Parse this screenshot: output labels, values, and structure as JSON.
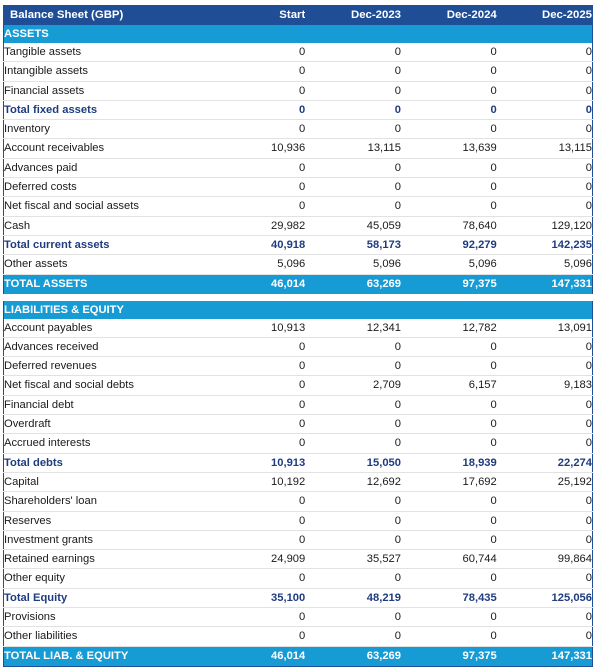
{
  "theme": {
    "header_bg": "#1F4E96",
    "section_bg": "#169BD5",
    "total_bg": "#169BD5",
    "subtotal_text": "#1F3C80",
    "body_text": "#1a1a1a",
    "row_rule": "#E2E2E2"
  },
  "header": {
    "title": "Balance Sheet (GBP)",
    "columns": [
      "Start",
      "Dec-2023",
      "Dec-2024",
      "Dec-2025"
    ]
  },
  "sections": [
    {
      "id": "assets",
      "band_label": "ASSETS",
      "rows": [
        {
          "label": "Tangible assets",
          "emphasis": "normal",
          "values": [
            "0",
            "0",
            "0",
            "0"
          ]
        },
        {
          "label": "Intangible assets",
          "emphasis": "normal",
          "values": [
            "0",
            "0",
            "0",
            "0"
          ]
        },
        {
          "label": "Financial assets",
          "emphasis": "normal",
          "values": [
            "0",
            "0",
            "0",
            "0"
          ]
        },
        {
          "label": "Total fixed assets",
          "emphasis": "subtotal",
          "values": [
            "0",
            "0",
            "0",
            "0"
          ]
        },
        {
          "label": "Inventory",
          "emphasis": "normal",
          "values": [
            "0",
            "0",
            "0",
            "0"
          ]
        },
        {
          "label": "Account receivables",
          "emphasis": "normal",
          "values": [
            "10,936",
            "13,115",
            "13,639",
            "13,115"
          ]
        },
        {
          "label": "Advances paid",
          "emphasis": "normal",
          "values": [
            "0",
            "0",
            "0",
            "0"
          ]
        },
        {
          "label": "Deferred costs",
          "emphasis": "normal",
          "values": [
            "0",
            "0",
            "0",
            "0"
          ]
        },
        {
          "label": "Net fiscal and social assets",
          "emphasis": "normal",
          "values": [
            "0",
            "0",
            "0",
            "0"
          ]
        },
        {
          "label": "Cash",
          "emphasis": "normal",
          "values": [
            "29,982",
            "45,059",
            "78,640",
            "129,120"
          ]
        },
        {
          "label": "Total current assets",
          "emphasis": "subtotal",
          "values": [
            "40,918",
            "58,173",
            "92,279",
            "142,235"
          ]
        },
        {
          "label": "Other assets",
          "emphasis": "normal",
          "values": [
            "5,096",
            "5,096",
            "5,096",
            "5,096"
          ]
        }
      ],
      "total": {
        "label": "TOTAL ASSETS",
        "values": [
          "46,014",
          "63,269",
          "97,375",
          "147,331"
        ]
      }
    },
    {
      "id": "liabilities-equity",
      "band_label": "LIABILITIES & EQUITY",
      "rows": [
        {
          "label": "Account payables",
          "emphasis": "normal",
          "values": [
            "10,913",
            "12,341",
            "12,782",
            "13,091"
          ]
        },
        {
          "label": "Advances received",
          "emphasis": "normal",
          "values": [
            "0",
            "0",
            "0",
            "0"
          ]
        },
        {
          "label": "Deferred revenues",
          "emphasis": "normal",
          "values": [
            "0",
            "0",
            "0",
            "0"
          ]
        },
        {
          "label": "Net fiscal and social debts",
          "emphasis": "normal",
          "values": [
            "0",
            "2,709",
            "6,157",
            "9,183"
          ]
        },
        {
          "label": "Financial debt",
          "emphasis": "normal",
          "values": [
            "0",
            "0",
            "0",
            "0"
          ]
        },
        {
          "label": "Overdraft",
          "emphasis": "normal",
          "values": [
            "0",
            "0",
            "0",
            "0"
          ]
        },
        {
          "label": "Accrued interests",
          "emphasis": "normal",
          "values": [
            "0",
            "0",
            "0",
            "0"
          ]
        },
        {
          "label": "Total debts",
          "emphasis": "subtotal",
          "values": [
            "10,913",
            "15,050",
            "18,939",
            "22,274"
          ]
        },
        {
          "label": "Capital",
          "emphasis": "normal",
          "values": [
            "10,192",
            "12,692",
            "17,692",
            "25,192"
          ]
        },
        {
          "label": "Shareholders' loan",
          "emphasis": "normal",
          "values": [
            "0",
            "0",
            "0",
            "0"
          ]
        },
        {
          "label": "Reserves",
          "emphasis": "normal",
          "values": [
            "0",
            "0",
            "0",
            "0"
          ]
        },
        {
          "label": "Investment grants",
          "emphasis": "normal",
          "values": [
            "0",
            "0",
            "0",
            "0"
          ]
        },
        {
          "label": "Retained earnings",
          "emphasis": "normal",
          "values": [
            "24,909",
            "35,527",
            "60,744",
            "99,864"
          ]
        },
        {
          "label": "Other equity",
          "emphasis": "normal",
          "values": [
            "0",
            "0",
            "0",
            "0"
          ]
        },
        {
          "label": "Total Equity",
          "emphasis": "subtotal",
          "values": [
            "35,100",
            "48,219",
            "78,435",
            "125,056"
          ]
        },
        {
          "label": "Provisions",
          "emphasis": "normal",
          "values": [
            "0",
            "0",
            "0",
            "0"
          ]
        },
        {
          "label": "Other liabilities",
          "emphasis": "normal",
          "values": [
            "0",
            "0",
            "0",
            "0"
          ]
        }
      ],
      "total": {
        "label": "TOTAL LIAB. & EQUITY",
        "values": [
          "46,014",
          "63,269",
          "97,375",
          "147,331"
        ]
      }
    }
  ],
  "chart_data": {
    "type": "table",
    "title": "Balance Sheet (GBP)",
    "columns": [
      "Start",
      "Dec-2023",
      "Dec-2024",
      "Dec-2025"
    ],
    "rows": [
      {
        "section": "ASSETS",
        "label": "Tangible assets",
        "values": [
          0,
          0,
          0,
          0
        ]
      },
      {
        "section": "ASSETS",
        "label": "Intangible assets",
        "values": [
          0,
          0,
          0,
          0
        ]
      },
      {
        "section": "ASSETS",
        "label": "Financial assets",
        "values": [
          0,
          0,
          0,
          0
        ]
      },
      {
        "section": "ASSETS",
        "label": "Total fixed assets",
        "values": [
          0,
          0,
          0,
          0
        ]
      },
      {
        "section": "ASSETS",
        "label": "Inventory",
        "values": [
          0,
          0,
          0,
          0
        ]
      },
      {
        "section": "ASSETS",
        "label": "Account receivables",
        "values": [
          10936,
          13115,
          13639,
          13115
        ]
      },
      {
        "section": "ASSETS",
        "label": "Advances paid",
        "values": [
          0,
          0,
          0,
          0
        ]
      },
      {
        "section": "ASSETS",
        "label": "Deferred costs",
        "values": [
          0,
          0,
          0,
          0
        ]
      },
      {
        "section": "ASSETS",
        "label": "Net fiscal and social assets",
        "values": [
          0,
          0,
          0,
          0
        ]
      },
      {
        "section": "ASSETS",
        "label": "Cash",
        "values": [
          29982,
          45059,
          78640,
          129120
        ]
      },
      {
        "section": "ASSETS",
        "label": "Total current assets",
        "values": [
          40918,
          58173,
          92279,
          142235
        ]
      },
      {
        "section": "ASSETS",
        "label": "Other assets",
        "values": [
          5096,
          5096,
          5096,
          5096
        ]
      },
      {
        "section": "ASSETS",
        "label": "TOTAL ASSETS",
        "values": [
          46014,
          63269,
          97375,
          147331
        ]
      },
      {
        "section": "LIABILITIES & EQUITY",
        "label": "Account payables",
        "values": [
          10913,
          12341,
          12782,
          13091
        ]
      },
      {
        "section": "LIABILITIES & EQUITY",
        "label": "Advances received",
        "values": [
          0,
          0,
          0,
          0
        ]
      },
      {
        "section": "LIABILITIES & EQUITY",
        "label": "Deferred revenues",
        "values": [
          0,
          0,
          0,
          0
        ]
      },
      {
        "section": "LIABILITIES & EQUITY",
        "label": "Net fiscal and social debts",
        "values": [
          0,
          2709,
          6157,
          9183
        ]
      },
      {
        "section": "LIABILITIES & EQUITY",
        "label": "Financial debt",
        "values": [
          0,
          0,
          0,
          0
        ]
      },
      {
        "section": "LIABILITIES & EQUITY",
        "label": "Overdraft",
        "values": [
          0,
          0,
          0,
          0
        ]
      },
      {
        "section": "LIABILITIES & EQUITY",
        "label": "Accrued interests",
        "values": [
          0,
          0,
          0,
          0
        ]
      },
      {
        "section": "LIABILITIES & EQUITY",
        "label": "Total debts",
        "values": [
          10913,
          15050,
          18939,
          22274
        ]
      },
      {
        "section": "LIABILITIES & EQUITY",
        "label": "Capital",
        "values": [
          10192,
          12692,
          17692,
          25192
        ]
      },
      {
        "section": "LIABILITIES & EQUITY",
        "label": "Shareholders' loan",
        "values": [
          0,
          0,
          0,
          0
        ]
      },
      {
        "section": "LIABILITIES & EQUITY",
        "label": "Reserves",
        "values": [
          0,
          0,
          0,
          0
        ]
      },
      {
        "section": "LIABILITIES & EQUITY",
        "label": "Investment grants",
        "values": [
          0,
          0,
          0,
          0
        ]
      },
      {
        "section": "LIABILITIES & EQUITY",
        "label": "Retained earnings",
        "values": [
          24909,
          35527,
          60744,
          99864
        ]
      },
      {
        "section": "LIABILITIES & EQUITY",
        "label": "Other equity",
        "values": [
          0,
          0,
          0,
          0
        ]
      },
      {
        "section": "LIABILITIES & EQUITY",
        "label": "Total Equity",
        "values": [
          35100,
          48219,
          78435,
          125056
        ]
      },
      {
        "section": "LIABILITIES & EQUITY",
        "label": "Provisions",
        "values": [
          0,
          0,
          0,
          0
        ]
      },
      {
        "section": "LIABILITIES & EQUITY",
        "label": "Other liabilities",
        "values": [
          0,
          0,
          0,
          0
        ]
      },
      {
        "section": "LIABILITIES & EQUITY",
        "label": "TOTAL LIAB. & EQUITY",
        "values": [
          46014,
          63269,
          97375,
          147331
        ]
      }
    ]
  }
}
